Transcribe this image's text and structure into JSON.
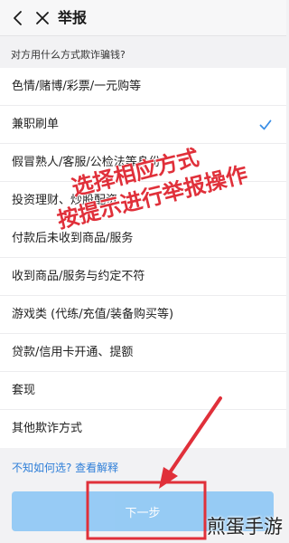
{
  "header": {
    "title": "举报"
  },
  "question": "对方用什么方式欺诈骗钱?",
  "options": [
    {
      "label": "色情/赌博/彩票/一元购等",
      "selected": false
    },
    {
      "label": "兼职刷单",
      "selected": true
    },
    {
      "label": "假冒熟人/客服/公检法等身份",
      "selected": false
    },
    {
      "label": "投资理财、炒股配资",
      "selected": false
    },
    {
      "label": "付款后未收到商品/服务",
      "selected": false
    },
    {
      "label": "收到商品/服务与约定不符",
      "selected": false
    },
    {
      "label": "游戏类 (代练/充值/装备购买等)",
      "selected": false
    },
    {
      "label": "贷款/信用卡开通、提额",
      "selected": false
    },
    {
      "label": "套现",
      "selected": false
    },
    {
      "label": "其他欺诈方式",
      "selected": false
    }
  ],
  "help_link": "不知如何选? 查看解释",
  "next_button": "下一步",
  "annotation": {
    "line1": "选择相应方式",
    "line2": "按提示进行举报操作"
  },
  "watermark": "煎蛋手游",
  "colors": {
    "accent": "#2f7fd8",
    "check": "#3a8ee6",
    "button": "#8fc8f4",
    "annotation": "#e0303a"
  },
  "icons": {
    "back": "back-icon",
    "close": "close-icon",
    "check": "check-icon",
    "arrow": "arrow-icon"
  }
}
